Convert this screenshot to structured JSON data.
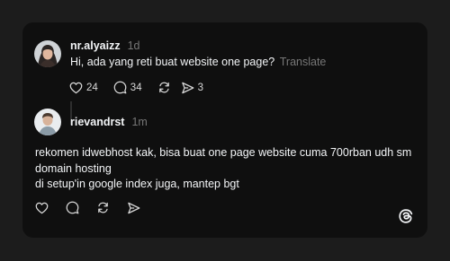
{
  "post": {
    "username": "nr.alyaizz",
    "time": "1d",
    "text": "Hi, ada yang reti buat website one page?",
    "translate_label": "Translate",
    "likes": "24",
    "replies": "34",
    "shares": "3"
  },
  "reply": {
    "username": "rievandrst",
    "time": "1m",
    "lines": [
      "rekomen idwebhost kak, bisa buat one page website cuma 700rban udh sm",
      "domain hosting",
      "di setup'in google index juga, mantep bgt"
    ]
  },
  "icons": {
    "like": "heart-icon",
    "reply": "comment-icon",
    "repost": "repost-icon",
    "share": "send-icon",
    "brand": "threads-logo-icon"
  },
  "colors": {
    "background": "#1c1c1c",
    "card": "#0f0f0f",
    "text": "#f3f5f7",
    "muted": "#777777"
  }
}
